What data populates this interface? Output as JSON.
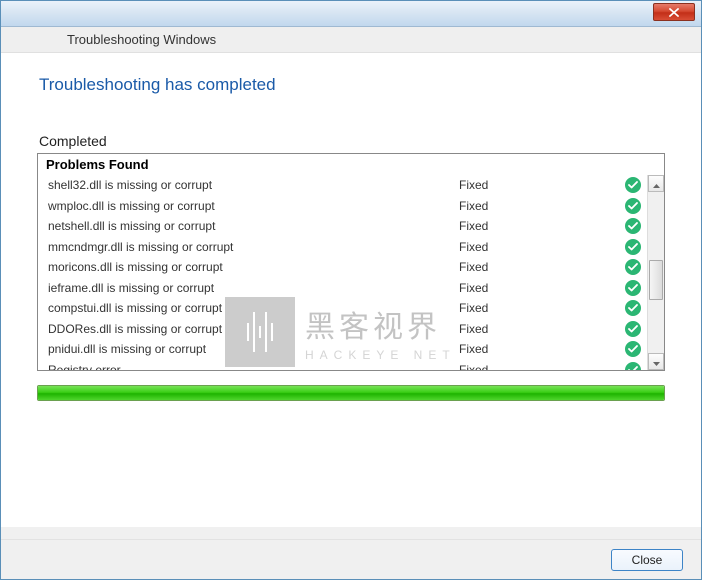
{
  "window": {
    "header_title": "Troubleshooting Windows"
  },
  "main": {
    "title": "Troubleshooting has completed",
    "section_label": "Completed",
    "problems_header": "Problems Found",
    "rows": [
      {
        "name": "shell32.dll is missing or corrupt",
        "status": "Fixed"
      },
      {
        "name": "wmploc.dll is missing or corrupt",
        "status": "Fixed"
      },
      {
        "name": "netshell.dll is missing or corrupt",
        "status": "Fixed"
      },
      {
        "name": "mmcndmgr.dll is missing or corrupt",
        "status": "Fixed"
      },
      {
        "name": "moricons.dll is missing or corrupt",
        "status": "Fixed"
      },
      {
        "name": "ieframe.dll is missing or corrupt",
        "status": "Fixed"
      },
      {
        "name": "compstui.dll is missing or corrupt",
        "status": "Fixed"
      },
      {
        "name": "DDORes.dll is missing or corrupt",
        "status": "Fixed"
      },
      {
        "name": "pnidui.dll is missing or corrupt",
        "status": "Fixed"
      },
      {
        "name": "Registry error",
        "status": "Fixed"
      }
    ]
  },
  "footer": {
    "close_label": "Close"
  },
  "watermark": {
    "cn": "黑客视界",
    "en": "HACKEYE  NET"
  },
  "progress": {
    "percent": 100
  }
}
